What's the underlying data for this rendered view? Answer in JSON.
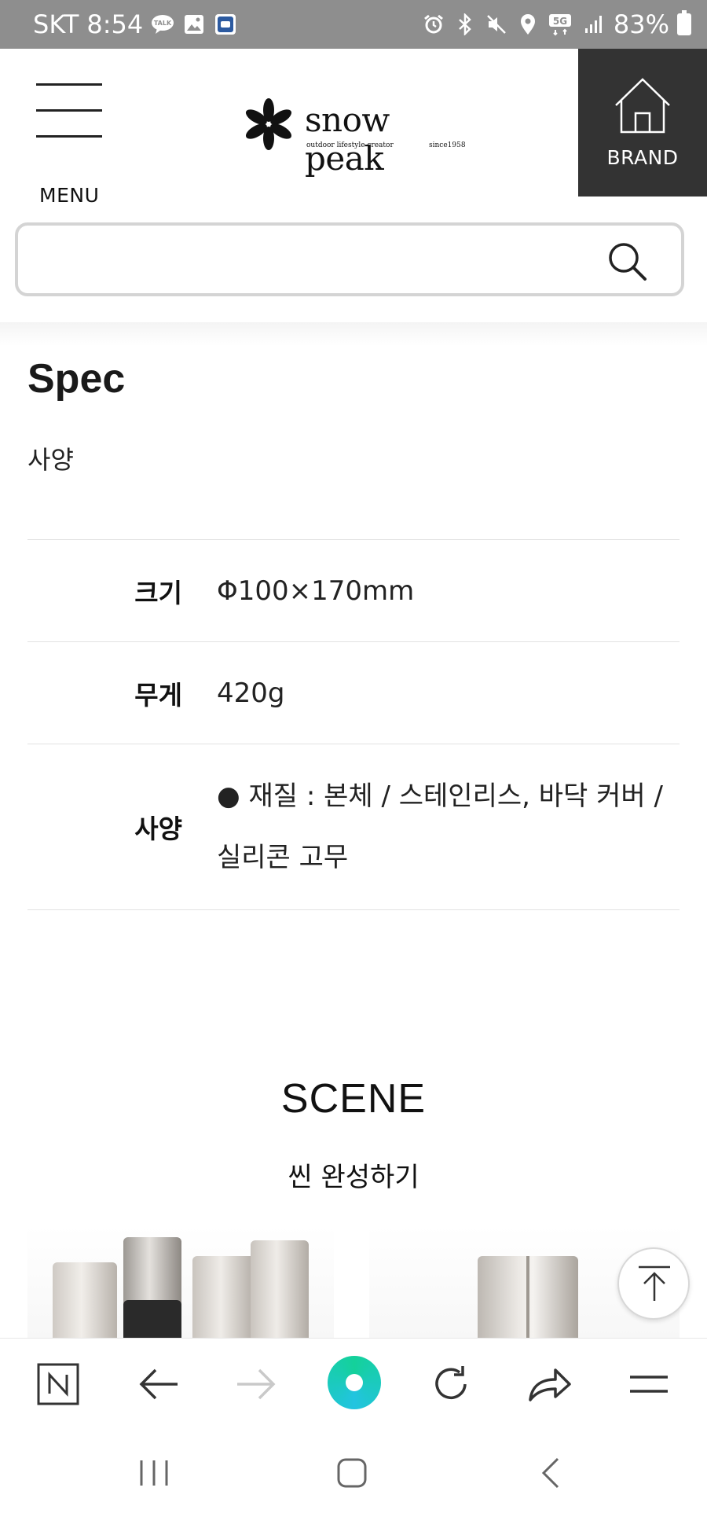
{
  "status_bar": {
    "carrier": "SKT",
    "time": "8:54",
    "battery": "83%",
    "network": "5G",
    "left_icons": [
      "talk-icon",
      "gallery-icon",
      "mobile-id-icon"
    ],
    "right_icons": [
      "alarm-icon",
      "bluetooth-icon",
      "mute-icon",
      "location-icon",
      "signal-icon",
      "battery-icon"
    ]
  },
  "header": {
    "menu_label": "MENU",
    "logo_text": "snow peak",
    "logo_tagline": "outdoor lifestyle creator",
    "logo_since": "since1958",
    "brand_label": "BRAND"
  },
  "search": {
    "placeholder": "",
    "value": ""
  },
  "spec": {
    "title": "Spec",
    "subtitle": "사양",
    "rows": [
      {
        "label": "크기",
        "value": "Φ100×170mm"
      },
      {
        "label": "무게",
        "value": "420g"
      },
      {
        "label": "사양",
        "value": "● 재질 : 본체 / 스테인리스, 바닥 커버 / 실리콘 고무"
      }
    ]
  },
  "scene": {
    "title": "SCENE",
    "subtitle": "씬 완성하기"
  },
  "browser_toolbar": {
    "buttons": [
      "naver-icon",
      "back-arrow-icon",
      "forward-arrow-icon",
      "home-green-icon",
      "reload-icon",
      "share-icon",
      "menu-lines-icon"
    ]
  },
  "colors": {
    "status_bar": "#8e8e8e",
    "brand_bg": "#333333",
    "accent_green": "#14d19a"
  }
}
